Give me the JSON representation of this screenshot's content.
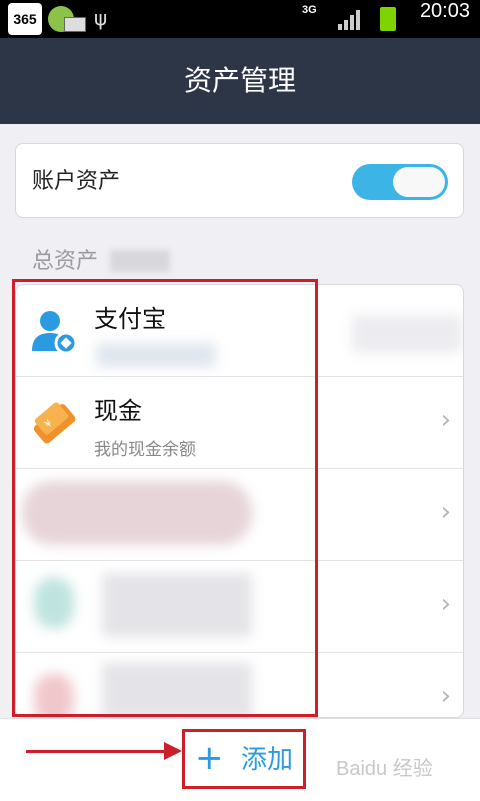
{
  "statusbar": {
    "app_badge": "365",
    "network": "3G",
    "time": "20:03"
  },
  "header": {
    "title": "资产管理"
  },
  "toggle": {
    "label": "账户资产",
    "state": "on",
    "color": "#3cb4e6"
  },
  "total": {
    "label": "总资产"
  },
  "accounts": [
    {
      "title": "支付宝",
      "icon": "alipay-user-icon"
    },
    {
      "title": "现金",
      "subtitle": "我的现金余额",
      "icon": "cash-wallet-icon"
    }
  ],
  "footer": {
    "add_label": "添加",
    "plus_icon": "plus-icon",
    "watermark": "Baidu 经验"
  }
}
